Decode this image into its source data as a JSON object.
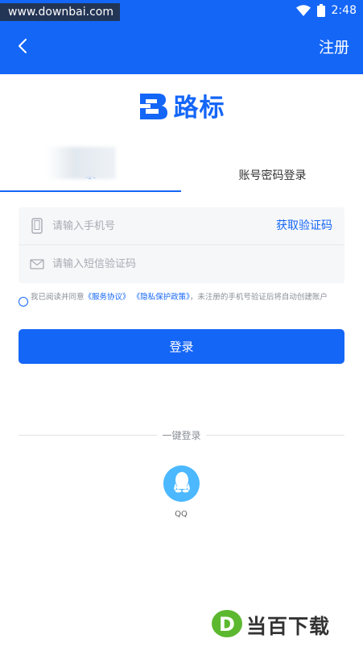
{
  "status_bar": {
    "watermark": "www.downbai.com",
    "time": "2:48"
  },
  "app_bar": {
    "register_label": "注册"
  },
  "logo": {
    "text": "路标"
  },
  "tabs": [
    {
      "label": "录"
    },
    {
      "label": "账号密码登录"
    }
  ],
  "form": {
    "phone_placeholder": "请输入手机号",
    "phone_value": "",
    "get_code_label": "获取验证码",
    "code_placeholder": "请输入短信验证码",
    "code_value": ""
  },
  "agreement": {
    "prefix": "我已阅读并同意",
    "service_link": "《服务协议》",
    "privacy_link": "《隐私保护政策》",
    "suffix": "，未注册的手机号验证后将自动创建账户"
  },
  "login_button": {
    "label": "登录"
  },
  "oneclick": {
    "label": "一键登录",
    "qq_label": "QQ"
  },
  "watermark_bottom": {
    "text": "当百下载"
  },
  "colors": {
    "primary": "#1466f7",
    "qq": "#4bb8ff",
    "input_bg": "#f6f7f9"
  }
}
